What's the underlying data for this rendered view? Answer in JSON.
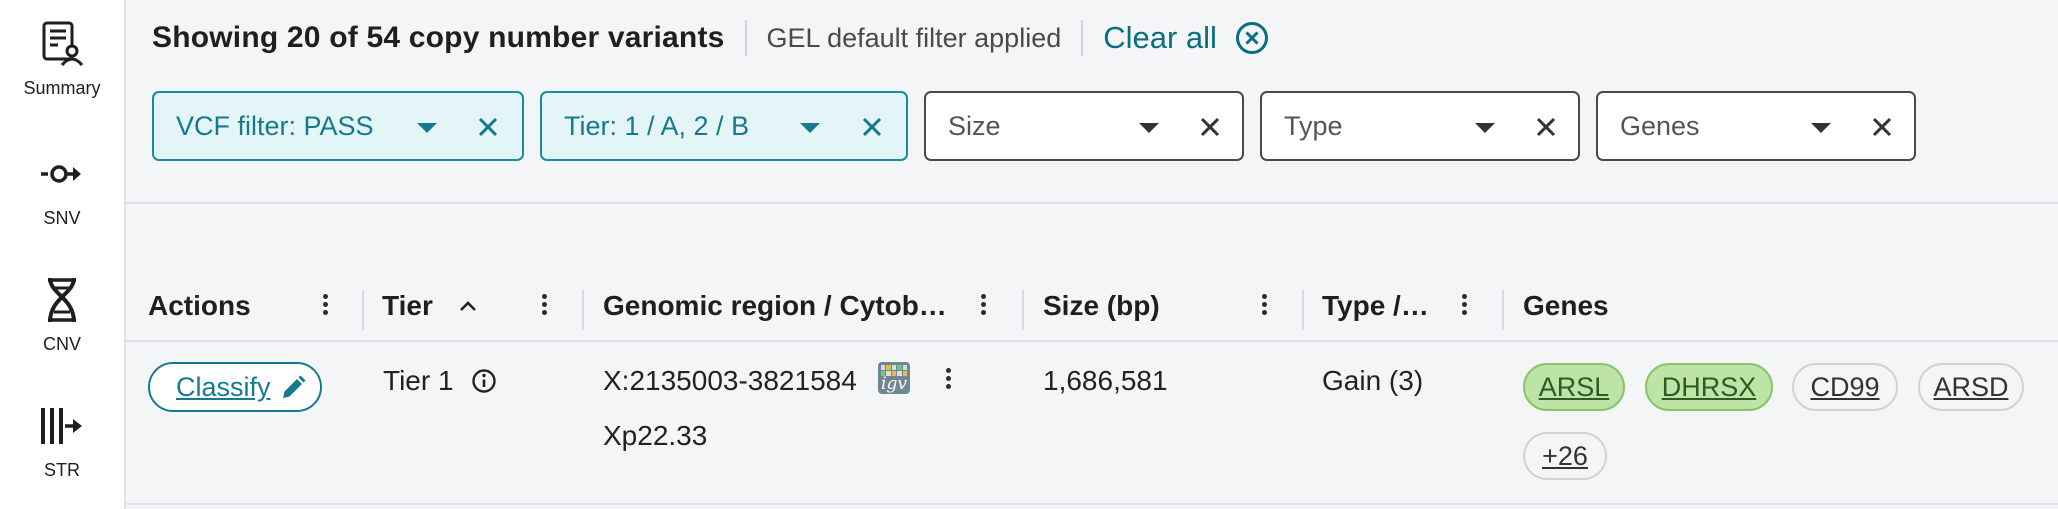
{
  "nav": {
    "items": [
      {
        "label": "Summary",
        "icon": "summary-report-icon"
      },
      {
        "label": "SNV",
        "icon": "snv-icon"
      },
      {
        "label": "CNV",
        "icon": "dna-helix-icon"
      },
      {
        "label": "STR",
        "icon": "str-icon"
      }
    ]
  },
  "summary": {
    "count_text": "Showing 20 of 54 copy number variants",
    "filter_note": "GEL default filter applied",
    "clear_all": "Clear all"
  },
  "filters": [
    {
      "label": "VCF filter: PASS",
      "active": true
    },
    {
      "label": "Tier: 1 / A, 2 / B",
      "active": true
    },
    {
      "label": "Size",
      "active": false
    },
    {
      "label": "Type",
      "active": false
    },
    {
      "label": "Genes",
      "active": false
    }
  ],
  "table": {
    "columns": [
      "Actions",
      "Tier",
      "Genomic region / Cytob…",
      "Size (bp)",
      "Type /…",
      "Genes"
    ],
    "rows": [
      {
        "action": "Classify",
        "tier": "Tier 1",
        "region": "X:2135003-3821584",
        "cytoband": "Xp22.33",
        "igv": "igv",
        "size": "1,686,581",
        "type": "Gain (3)",
        "genes": [
          {
            "name": "ARSL",
            "highlight": true
          },
          {
            "name": "DHRSX",
            "highlight": true
          },
          {
            "name": "CD99",
            "highlight": false
          },
          {
            "name": "ARSD",
            "highlight": false
          }
        ],
        "more_genes": "+26"
      }
    ]
  },
  "colors": {
    "accent": "#167a8f",
    "chip_active_bg": "#e4f5f8",
    "gene_highlight_bg": "#bde3a6"
  }
}
